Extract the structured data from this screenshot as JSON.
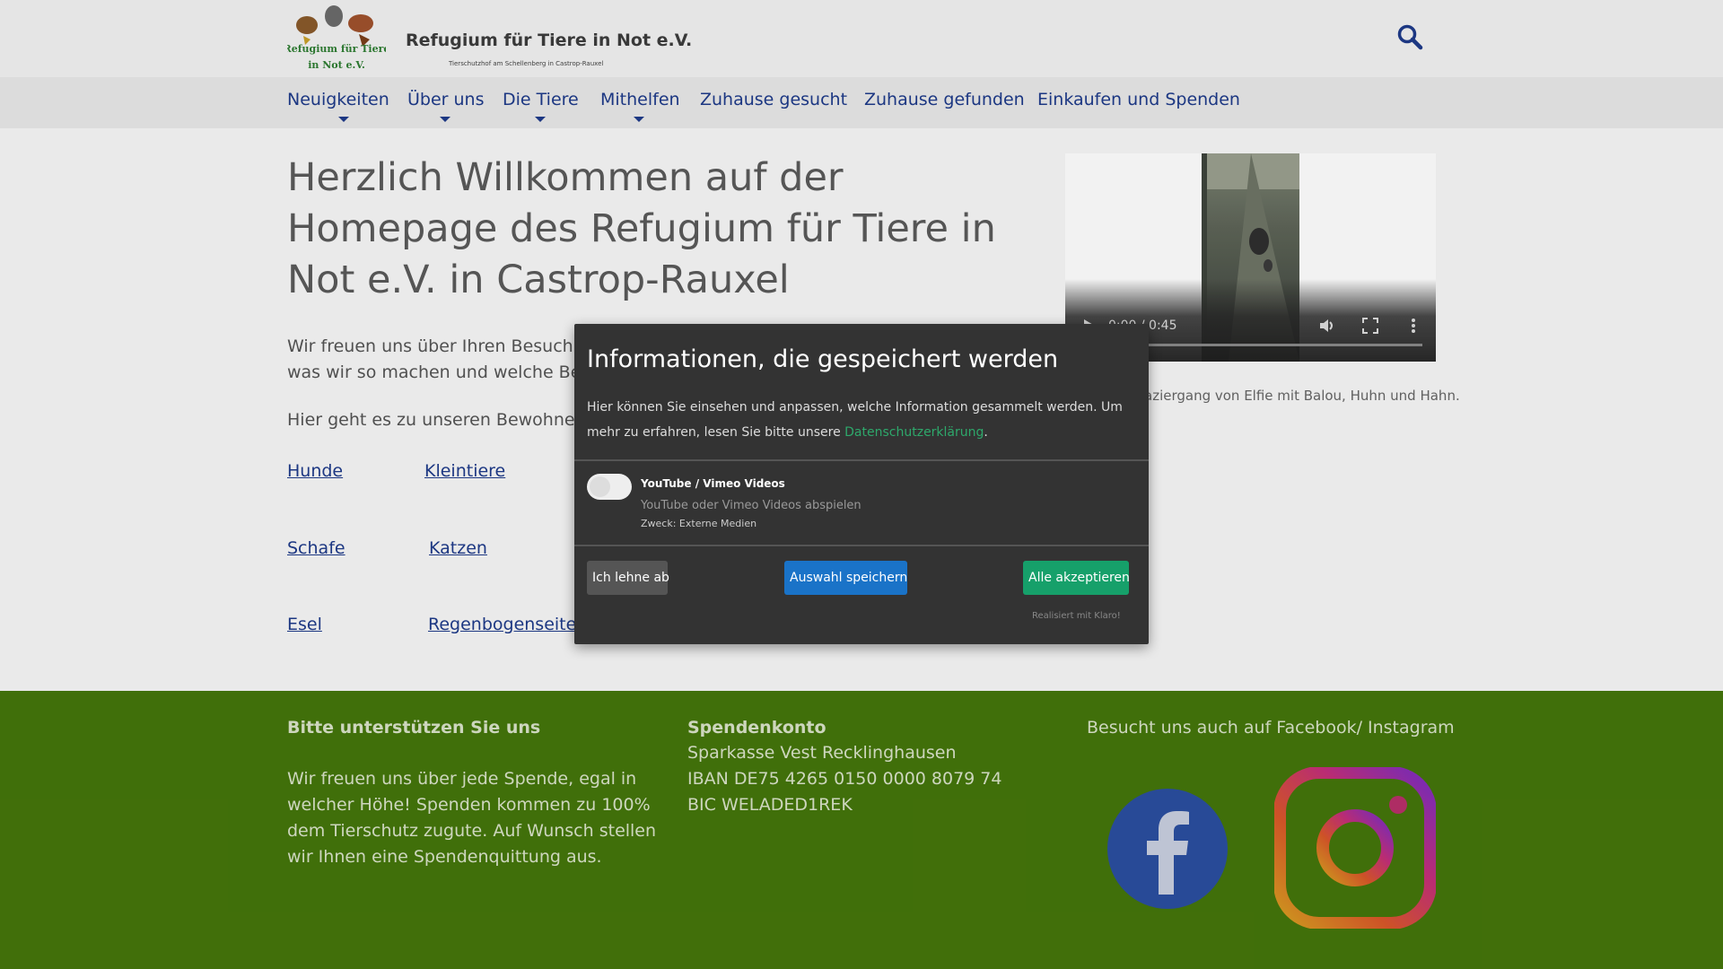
{
  "header": {
    "logo_title": "Refugium für Tiere in Not e.V.",
    "logo_subtitle": "Tierschutzhof am Schellenberg in Castrop-Rauxel",
    "logo_badge_line1": "Refugium für Tiere",
    "logo_badge_line2": "in Not e.V.",
    "search_icon": "search-icon"
  },
  "nav": {
    "items": [
      {
        "label": "Neuigkeiten",
        "has_submenu": true
      },
      {
        "label": "Über uns",
        "has_submenu": true
      },
      {
        "label": "Die Tiere",
        "has_submenu": true
      },
      {
        "label": "Mithelfen",
        "has_submenu": true
      },
      {
        "label": "Zuhause gesucht",
        "has_submenu": false
      },
      {
        "label": "Zuhause gefunden",
        "has_submenu": false
      },
      {
        "label": "Einkaufen und Spenden",
        "has_submenu": false
      }
    ]
  },
  "main": {
    "title": "Herzlich Willkommen auf der Homepage des Refugium für Tiere in Not e.V. in Castrop-Rauxel",
    "intro_line1": "Wir freuen uns über Ihren Besuch au",
    "intro_line2": "was wir so machen und welche Bew",
    "residents_text": "Hier geht es zu unseren Bewohnern",
    "animal_links": [
      "Hunde",
      "Kleintiere",
      "Schafe",
      "Katzen",
      "Esel",
      "Regenbogenseite"
    ]
  },
  "video": {
    "time": "0:00 / 0:45",
    "caption": "aziergang von Elfie mit Balou, Huhn und Hahn.",
    "progress": 0
  },
  "footer": {
    "support_heading": "Bitte unterstützen Sie uns",
    "support_lines": [
      "Wir freuen uns über jede Spende, egal in",
      "welcher Höhe! Spenden kommen zu 100%",
      "dem Tierschutz zugute. Auf Wunsch stellen",
      "wir Ihnen eine Spendenquittung aus."
    ],
    "account_heading": "Spendenkonto",
    "account_lines": [
      "Sparkasse Vest Recklinghausen",
      "IBAN DE75 4265 0150 0000 8079 74",
      "BIC WELADED1REK"
    ],
    "social_heading": "Besucht uns auch auf Facebook/ Instagram",
    "social_icons": [
      "facebook-icon",
      "instagram-icon"
    ]
  },
  "consent_modal": {
    "title": "Informationen, die gespeichert werden",
    "description": "Hier können Sie einsehen und anpassen, welche Information gesammelt werden. Um mehr zu erfahren, lesen Sie bitte unsere ",
    "privacy_link": "Datenschutzerklärung",
    "description_end": ".",
    "service_name": "YouTube / Vimeo Videos",
    "service_description": "YouTube oder Vimeo Videos abspielen",
    "service_purpose": "Zweck: Externe Medien",
    "service_enabled": false,
    "decline_button": "Ich lehne ab",
    "save_button": "Auswahl speichern",
    "accept_button": "Alle akzeptieren",
    "credit": "Realisiert mit Klaro!"
  },
  "colors": {
    "nav_text": "#1e3a8a",
    "footer_bg": "#44750b",
    "modal_bg": "#333333",
    "accept": "#16a06a",
    "save": "#1a73c8",
    "privacy_link": "#2ea86b"
  }
}
